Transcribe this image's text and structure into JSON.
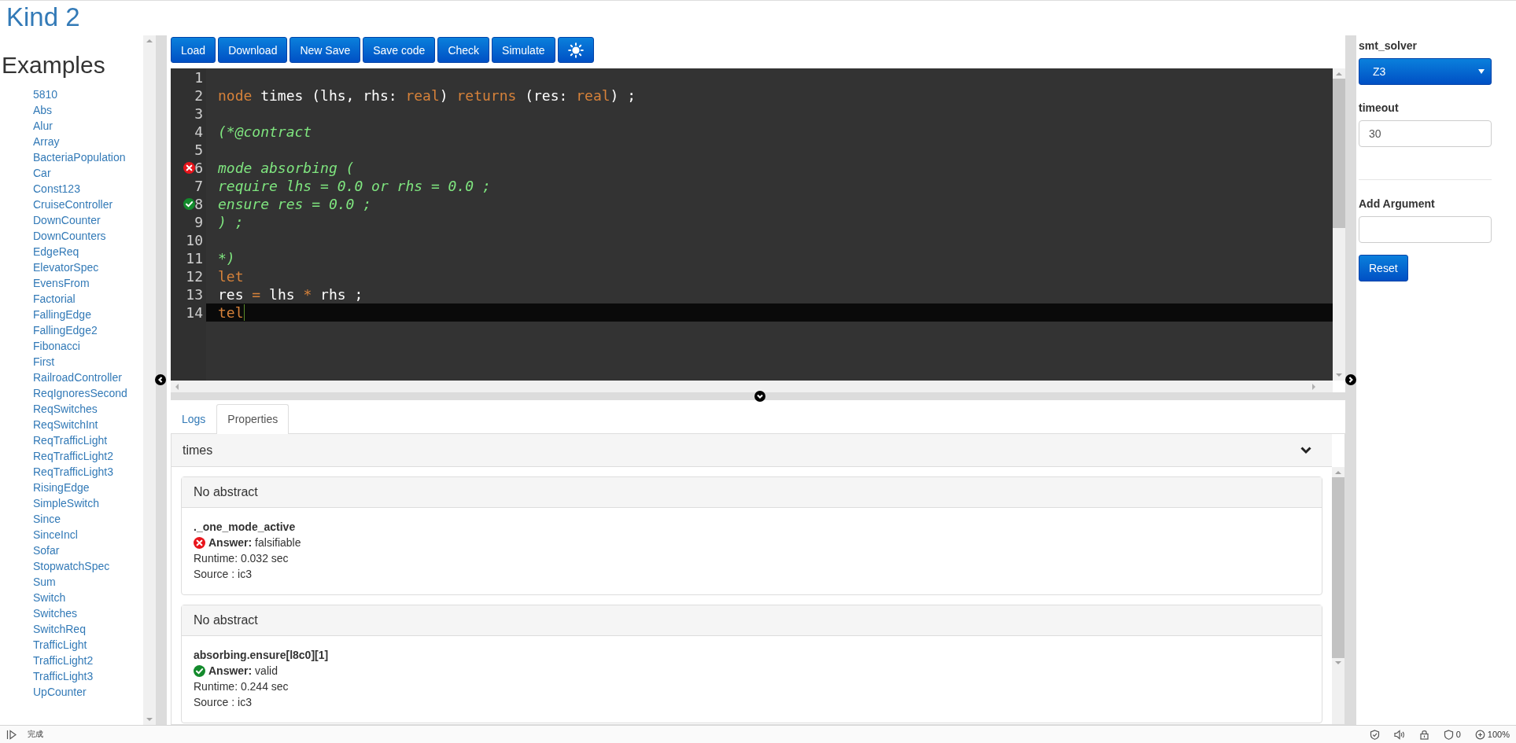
{
  "app": {
    "title": "Kind 2"
  },
  "sidebar": {
    "heading": "Examples",
    "items": [
      "5810",
      "Abs",
      "Alur",
      "Array",
      "BacteriaPopulation",
      "Car",
      "Const123",
      "CruiseController",
      "DownCounter",
      "DownCounters",
      "EdgeReq",
      "ElevatorSpec",
      "EvensFrom",
      "Factorial",
      "FallingEdge",
      "FallingEdge2",
      "Fibonacci",
      "First",
      "RailroadController",
      "ReqIgnoresSecond",
      "ReqSwitches",
      "ReqSwitchInt",
      "ReqTrafficLight",
      "ReqTrafficLight2",
      "ReqTrafficLight3",
      "RisingEdge",
      "SimpleSwitch",
      "Since",
      "SinceIncl",
      "Sofar",
      "StopwatchSpec",
      "Sum",
      "Switch",
      "Switches",
      "SwitchReq",
      "TrafficLight",
      "TrafficLight2",
      "TrafficLight3",
      "UpCounter"
    ]
  },
  "toolbar": {
    "buttons": [
      "Load",
      "Download",
      "New Save",
      "Save code",
      "Check",
      "Simulate"
    ]
  },
  "editor": {
    "lines": [
      {
        "number": "1",
        "kind": "plain",
        "current": false
      },
      {
        "number": "2",
        "kind": "plain",
        "current": false,
        "tokens": [
          {
            "text": "node",
            "kind": "keyword"
          },
          {
            "text": " times (lhs, rhs: ",
            "kind": "plain"
          },
          {
            "text": "real",
            "kind": "keyword"
          },
          {
            "text": ") ",
            "kind": "plain"
          },
          {
            "text": "returns",
            "kind": "keyword"
          },
          {
            "text": " (res: ",
            "kind": "plain"
          },
          {
            "text": "real",
            "kind": "keyword"
          },
          {
            "text": ") ;",
            "kind": "plain"
          }
        ]
      },
      {
        "number": "3",
        "kind": "plain",
        "current": false
      },
      {
        "number": "4",
        "kind": "plain",
        "current": false,
        "tokens": [
          {
            "text": "(*@contract",
            "kind": "comment"
          }
        ]
      },
      {
        "number": "5",
        "kind": "plain",
        "current": false
      },
      {
        "number": "6",
        "kind": "error",
        "current": false,
        "tokens": [
          {
            "text": "mode absorbing (",
            "kind": "comment"
          }
        ]
      },
      {
        "number": "7",
        "kind": "plain",
        "current": false,
        "tokens": [
          {
            "text": "require lhs = 0.0 or rhs = 0.0 ;",
            "kind": "comment"
          }
        ]
      },
      {
        "number": "8",
        "kind": "valid",
        "current": false,
        "tokens": [
          {
            "text": "ensure res = 0.0 ;",
            "kind": "comment"
          }
        ]
      },
      {
        "number": "9",
        "kind": "plain",
        "current": false,
        "tokens": [
          {
            "text": ") ;",
            "kind": "comment"
          }
        ]
      },
      {
        "number": "10",
        "kind": "plain",
        "current": false
      },
      {
        "number": "11",
        "kind": "plain",
        "current": false,
        "tokens": [
          {
            "text": "*)",
            "kind": "comment"
          }
        ]
      },
      {
        "number": "12",
        "kind": "plain",
        "current": false,
        "tokens": [
          {
            "text": "let",
            "kind": "keyword"
          }
        ]
      },
      {
        "number": "13",
        "kind": "plain",
        "current": false,
        "tokens": [
          {
            "text": "res ",
            "kind": "plain"
          },
          {
            "text": "=",
            "kind": "operator"
          },
          {
            "text": " lhs ",
            "kind": "plain"
          },
          {
            "text": "*",
            "kind": "operator"
          },
          {
            "text": " rhs ;",
            "kind": "plain"
          }
        ]
      },
      {
        "number": "14",
        "kind": "plain",
        "current": true,
        "tokens": [
          {
            "text": "tel",
            "kind": "keyword"
          }
        ]
      }
    ]
  },
  "results": {
    "tabs": [
      {
        "label": "Logs",
        "selected": false
      },
      {
        "label": "Properties",
        "selected": true
      }
    ],
    "node": {
      "name": "times"
    },
    "properties": [
      {
        "abstract": "No abstract",
        "name": "._one_mode_active",
        "kind": "falsifiable",
        "answer": "**Answer:** falsifiable",
        "runtime": "Runtime: 0.032 sec",
        "source": "Source : ic3"
      },
      {
        "abstract": "No abstract",
        "name": "absorbing.ensure[l8c0][1]",
        "kind": "valid",
        "answer": "**Answer:** valid",
        "runtime": "Runtime: 0.244 sec",
        "source": "Source : ic3"
      }
    ]
  },
  "settings": {
    "smt_solver": {
      "label": "smt_solver",
      "value": "Z3"
    },
    "timeout": {
      "label": "timeout",
      "value": "30"
    },
    "add_argument": {
      "label": "Add Argument"
    },
    "reset_button": "Reset"
  },
  "status_bar": {
    "status": "完成",
    "blocked_count": "0",
    "zoom": "100%"
  }
}
